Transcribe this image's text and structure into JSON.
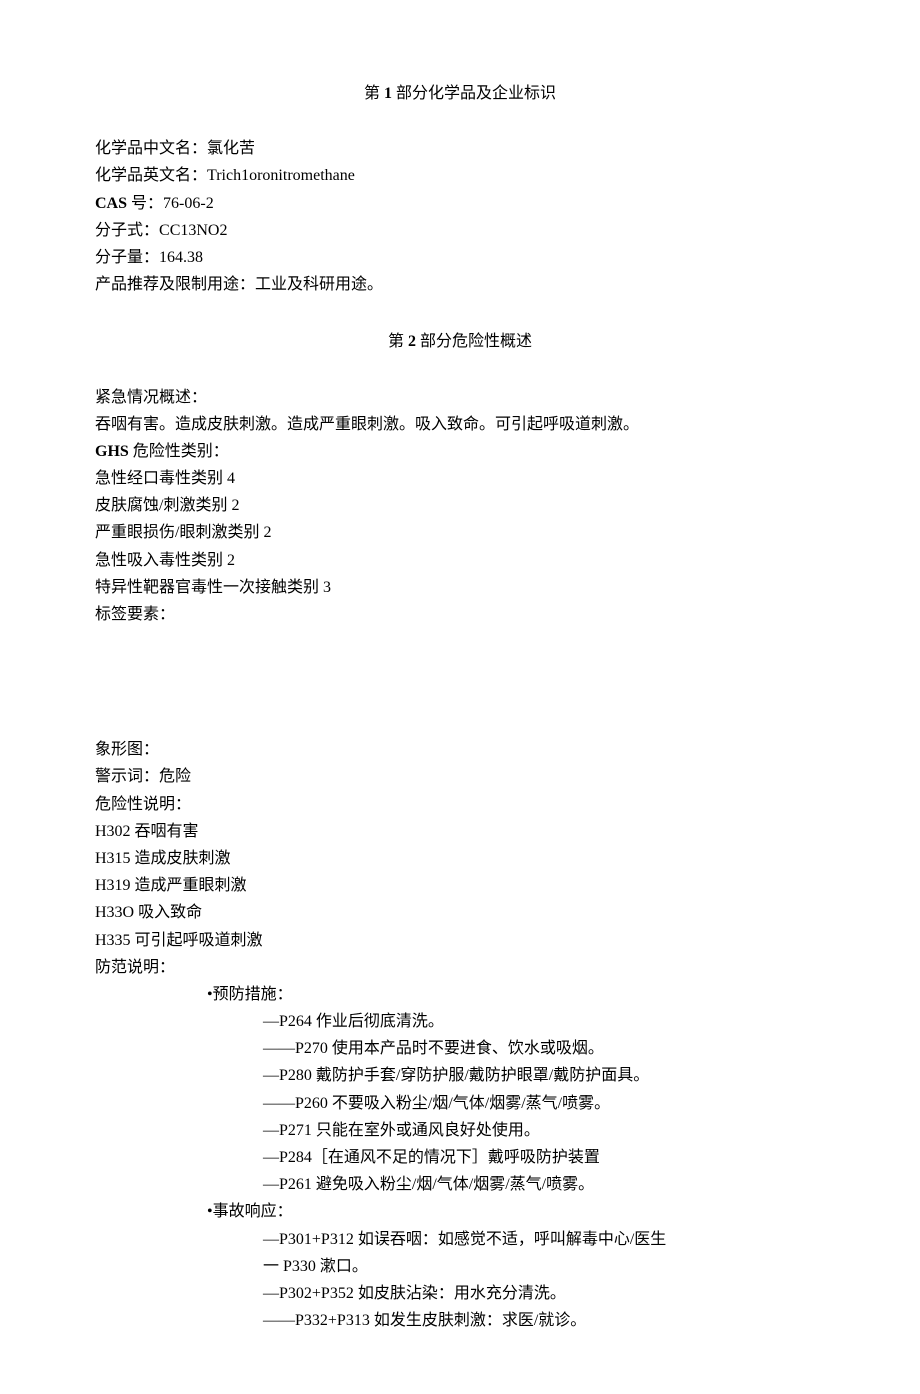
{
  "section1": {
    "heading_prefix": "第 ",
    "heading_num": "1",
    "heading_suffix": " 部分化学品及企业标识",
    "name_cn_label": "化学品中文名：",
    "name_cn_value": "氯化苦",
    "name_en_label": "化学品英文名：",
    "name_en_value": "Trich1oronitromethane",
    "cas_label": "CAS",
    "cas_suffix": " 号：",
    "cas_value": "76-06-2",
    "formula_label": "分子式：",
    "formula_value": "CC13NO2",
    "mw_label": "分子量：",
    "mw_value": "164.38",
    "usage_label": "产品推荐及限制用途：",
    "usage_value": "工业及科研用途。"
  },
  "section2": {
    "heading_prefix": "第 ",
    "heading_num": "2",
    "heading_suffix": " 部分危险性概述",
    "emergency_label": "紧急情况概述：",
    "emergency_text": "吞咽有害。造成皮肤刺激。造成严重眼刺激。吸入致命。可引起呼吸道刺激。",
    "ghs_label_prefix": "GHS",
    "ghs_label_suffix": " 危险性类别：",
    "ghs_items": [
      "急性经口毒性类别 4",
      "皮肤腐蚀/刺激类别 2",
      "严重眼损伤/眼刺激类别 2",
      "急性吸入毒性类别 2",
      "特异性靶器官毒性一次接触类别 3"
    ],
    "label_elements": "标签要素：",
    "pictogram_label": "象形图：",
    "signal_word_label": "警示词：",
    "signal_word_value": "危险",
    "hazard_statement_label": "危险性说明：",
    "hazard_statements": [
      "H302 吞咽有害",
      "H315 造成皮肤刺激",
      "H319 造成严重眼刺激",
      "H33O 吸入致命",
      "H335 可引起呼吸道刺激"
    ],
    "precaution_label": "防范说明：",
    "prevention_label": "•预防措施：",
    "prevention_items": [
      "—P264 作业后彻底清洗。",
      "——P270 使用本产品时不要进食、饮水或吸烟。",
      "—P280 戴防护手套/穿防护服/戴防护眼罩/戴防护面具。",
      "——P260 不要吸入粉尘/烟/气体/烟雾/蒸气/喷雾。",
      "—P271 只能在室外或通风良好处使用。",
      "—P284［在通风不足的情况下］戴呼吸防护装置",
      "—P261 避免吸入粉尘/烟/气体/烟雾/蒸气/喷雾。"
    ],
    "response_label": "•事故响应：",
    "response_items": [
      "—P301+P312 如误吞咽：如感觉不适，呼叫解毒中心/医生",
      "一 P330 漱口。",
      "—P302+P352 如皮肤沾染：用水充分清洗。",
      "——P332+P313 如发生皮肤刺激：求医/就诊。"
    ]
  }
}
